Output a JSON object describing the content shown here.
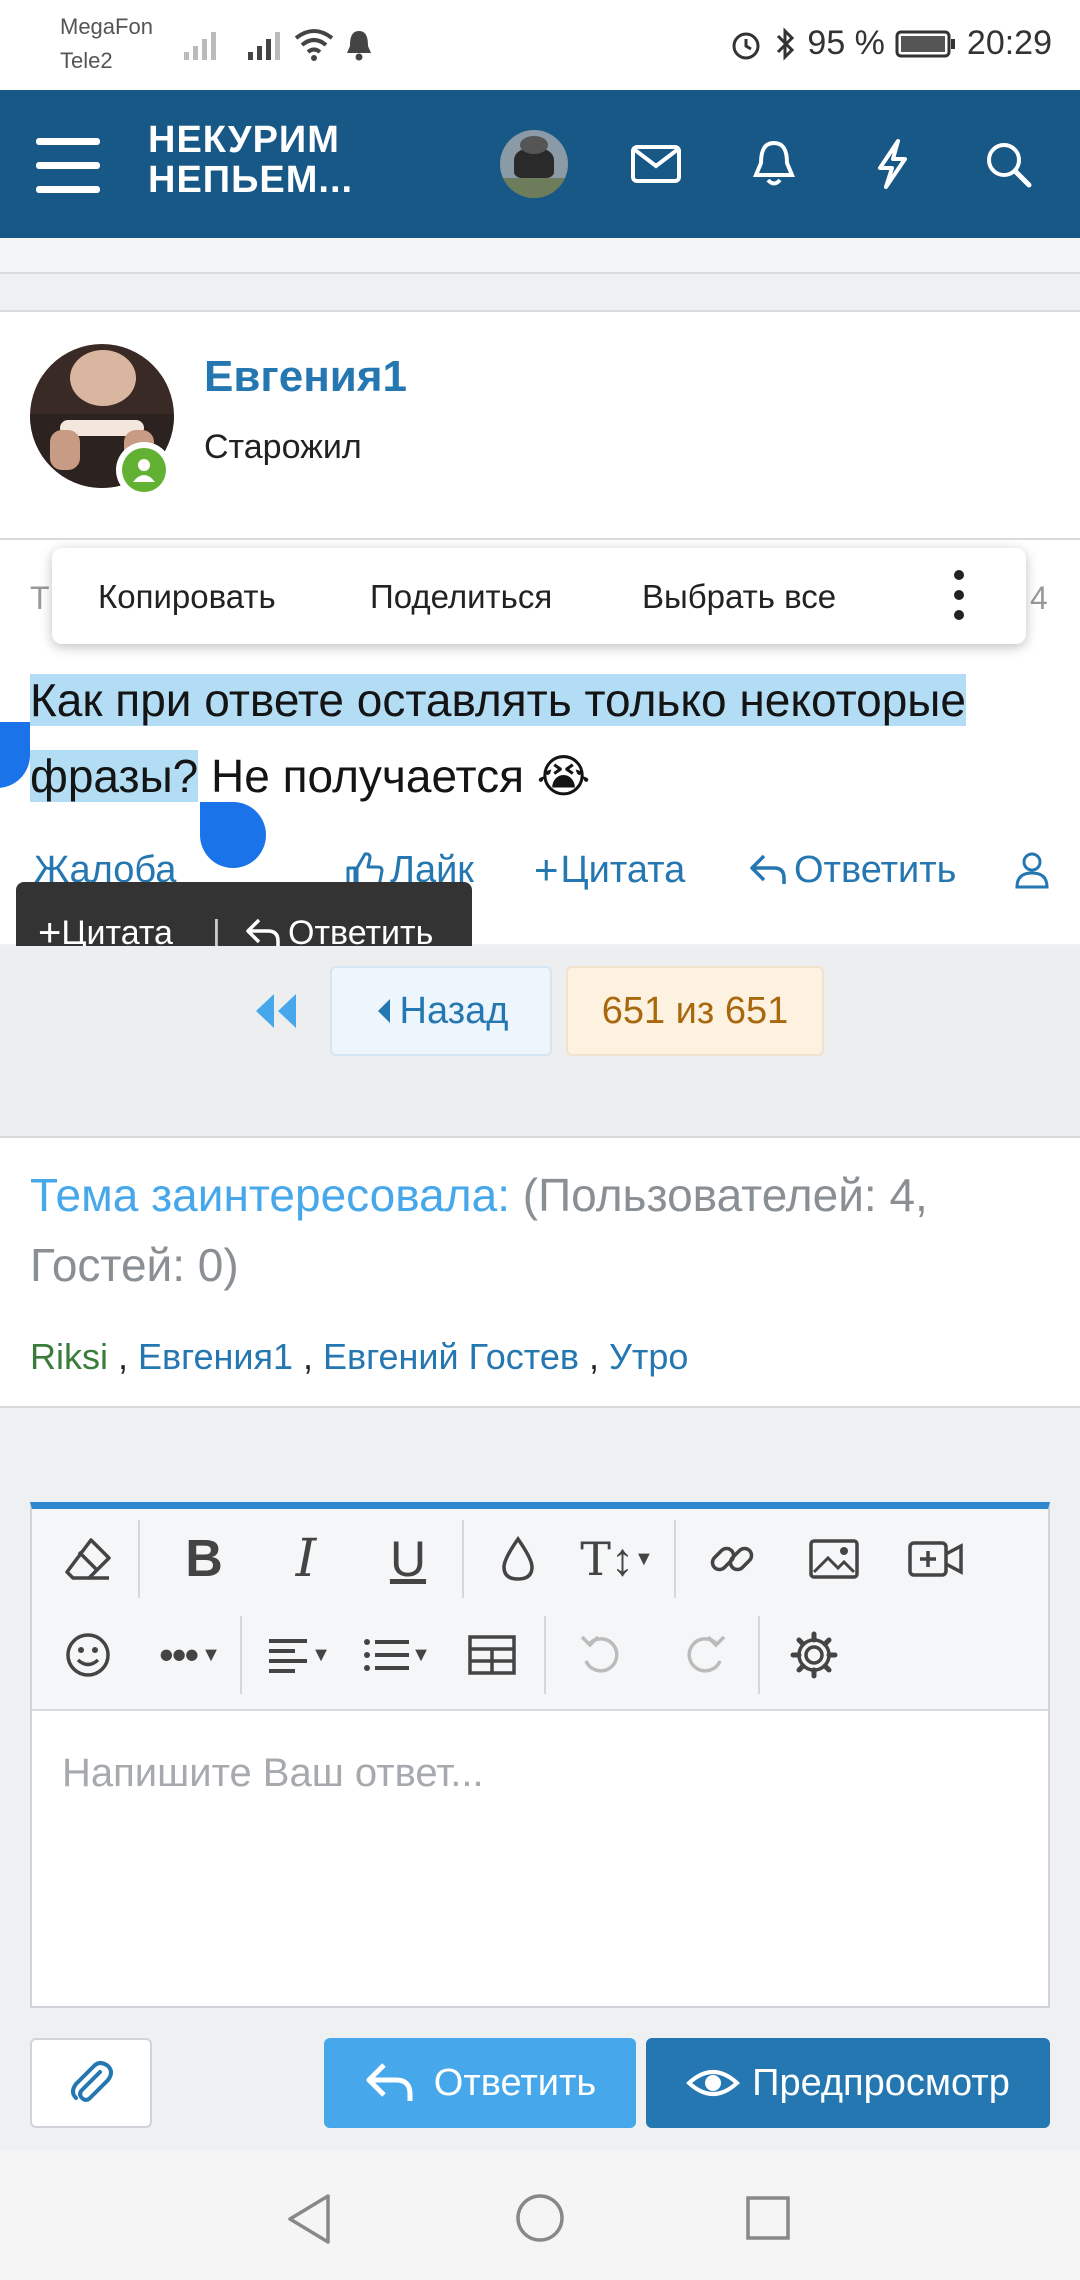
{
  "status_bar": {
    "carrier1": "MegaFon",
    "carrier2": "Tele2",
    "battery": "95 %",
    "time": "20:29"
  },
  "app_bar": {
    "logo_line1": "НЕКУРИМ",
    "logo_line2": "НЕПЬЕМ..."
  },
  "post": {
    "author": "Евгения1",
    "author_title": "Старожил",
    "text_selected_1": "Как при ответе оставлять только некоторые",
    "text_selected_2": "фразы?",
    "text_rest": " Не получается ",
    "emoji": "😭",
    "obscured_left": "Т",
    "obscured_right": "4",
    "actions": {
      "report": "Жалоба",
      "like": "Лайк",
      "quote": "Цитата",
      "reply": "Ответить"
    }
  },
  "context_menu": {
    "copy": "Копировать",
    "share": "Поделиться",
    "select_all": "Выбрать все"
  },
  "quote_popup": {
    "quote": "Цитата",
    "separator": "|",
    "reply": "Ответить"
  },
  "pagination": {
    "back": "Назад",
    "page_status": "651 из 651"
  },
  "interested": {
    "label": "Тема заинтересовала:",
    "counts": "(Пользователей: 4, Гостей: 0)",
    "users": [
      {
        "name": "Riksi",
        "color": "#3a7d3a"
      },
      {
        "name": "Евгения1",
        "color": "#2577b1"
      },
      {
        "name": "Евгений Гостев",
        "color": "#2577b1"
      },
      {
        "name": "Утро",
        "color": "#2577b1"
      }
    ]
  },
  "editor": {
    "placeholder": "Напишите Ваш ответ..."
  },
  "buttons": {
    "reply": "Ответить",
    "preview": "Предпросмотр"
  },
  "colors": {
    "header": "#185886",
    "link": "#2577b1",
    "selection": "#b3ddf4",
    "reply_button": "#47a7eb",
    "preview_button": "#2577b1"
  }
}
